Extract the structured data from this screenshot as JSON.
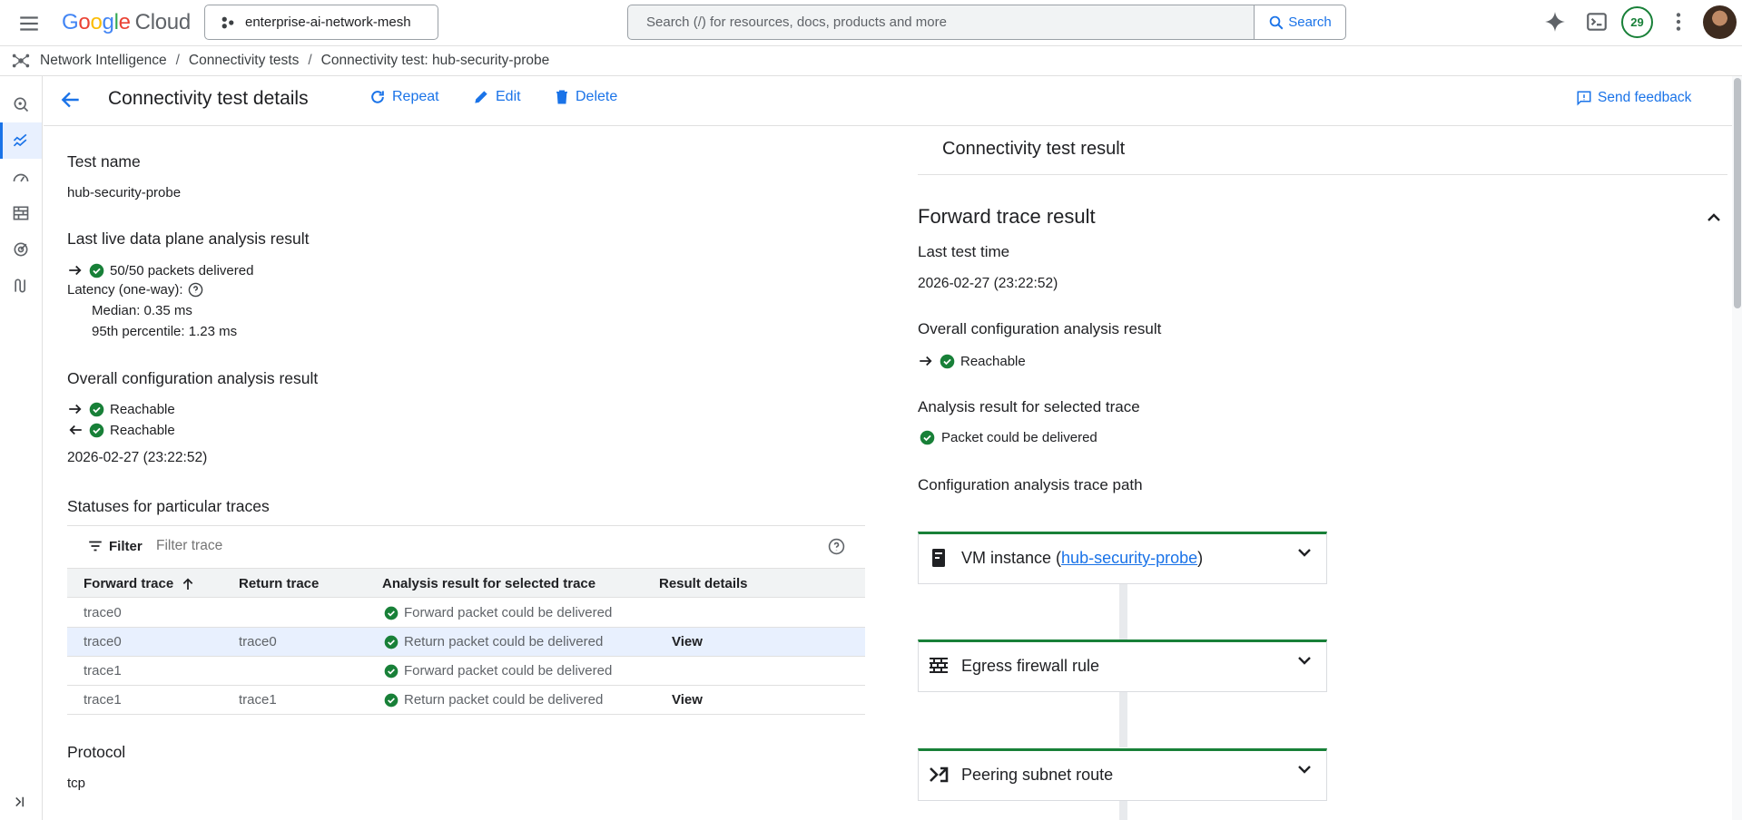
{
  "topbar": {
    "logo_letters": [
      "G",
      "o",
      "o",
      "g",
      "l",
      "e"
    ],
    "logo_cloud": "Cloud",
    "project": "enterprise-ai-network-mesh",
    "search_placeholder": "Search (/) for resources, docs, products and more",
    "search_button": "Search",
    "notifications_count": "29"
  },
  "breadcrumb": {
    "items": [
      "Network Intelligence",
      "Connectivity tests",
      "Connectivity test: hub-security-probe"
    ],
    "separator": "/"
  },
  "header": {
    "title": "Connectivity test details",
    "repeat": "Repeat",
    "edit": "Edit",
    "delete": "Delete",
    "feedback": "Send feedback"
  },
  "details": {
    "test_name_label": "Test name",
    "test_name": "hub-security-probe",
    "live_label": "Last live data plane analysis result",
    "packets": "50/50 packets delivered",
    "latency_label": "Latency (one-way):",
    "median": "Median: 0.35 ms",
    "p95": "95th percentile: 1.23 ms",
    "config_label": "Overall configuration analysis result",
    "forward_result": "Reachable",
    "return_result": "Reachable",
    "config_time": "2026-02-27 (23:22:52)",
    "statuses_label": "Statuses for particular traces",
    "protocol_label": "Protocol",
    "protocol": "tcp"
  },
  "traces_table": {
    "filter_label": "Filter",
    "filter_placeholder": "Filter trace",
    "columns": [
      "Forward trace",
      "Return trace",
      "Analysis result for selected trace",
      "Result details"
    ],
    "rows": [
      {
        "forward": "trace0",
        "return": "",
        "result": "Forward packet could be delivered",
        "details": ""
      },
      {
        "forward": "trace0",
        "return": "trace0",
        "result": "Return packet could be delivered",
        "details": "View"
      },
      {
        "forward": "trace1",
        "return": "",
        "result": "Forward packet could be delivered",
        "details": ""
      },
      {
        "forward": "trace1",
        "return": "trace1",
        "result": "Return packet could be delivered",
        "details": "View"
      }
    ]
  },
  "result_panel": {
    "title": "Connectivity test result",
    "forward_title": "Forward trace result",
    "last_time_label": "Last test time",
    "last_time": "2026-02-27 (23:22:52)",
    "overall_label": "Overall configuration analysis result",
    "overall_value": "Reachable",
    "selected_label": "Analysis result for selected trace",
    "selected_value": "Packet could be delivered",
    "path_label": "Configuration analysis trace path",
    "steps": [
      {
        "prefix": "VM instance (",
        "link": "hub-security-probe",
        "suffix": ")",
        "icon": "vm-instance-icon"
      },
      {
        "title": "Egress firewall rule",
        "icon": "firewall-icon"
      },
      {
        "title": "Peering subnet route",
        "icon": "route-icon"
      }
    ]
  },
  "colors": {
    "accent": "#1a73e8",
    "success": "#188038",
    "selected_row": "#e8f0fe"
  }
}
